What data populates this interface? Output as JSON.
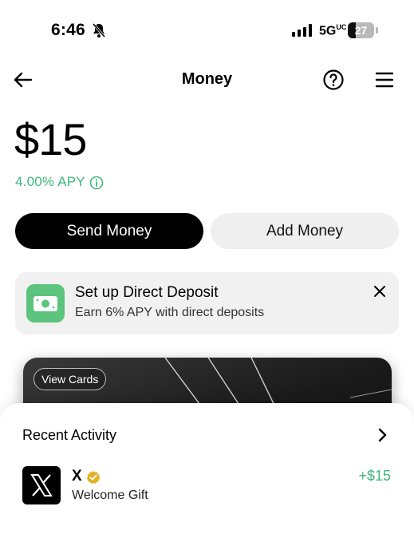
{
  "status_bar": {
    "time": "6:46",
    "network": "5G",
    "network_suffix": "UC",
    "battery": "27"
  },
  "header": {
    "title": "Money"
  },
  "balance": {
    "amount": "$15",
    "apy": "4.00% APY"
  },
  "actions": {
    "send_label": "Send Money",
    "add_label": "Add Money"
  },
  "promo": {
    "title": "Set up Direct Deposit",
    "subtitle": "Earn 6% APY with direct deposits"
  },
  "card": {
    "view_cards_label": "View Cards"
  },
  "recent_activity": {
    "title": "Recent Activity",
    "items": [
      {
        "name": "X",
        "description": "Welcome Gift",
        "amount": "+$15"
      }
    ]
  },
  "colors": {
    "accent_green": "#3fb67b",
    "promo_icon_green": "#5cc47c",
    "primary_button": "#000000",
    "secondary_button": "#efefef"
  },
  "icons": [
    "bell-muted-icon",
    "signal-icon",
    "battery-icon",
    "back-arrow-icon",
    "help-icon",
    "menu-icon",
    "info-icon",
    "cash-icon",
    "close-icon",
    "chevron-right-icon",
    "x-logo-icon",
    "verified-badge-icon"
  ]
}
